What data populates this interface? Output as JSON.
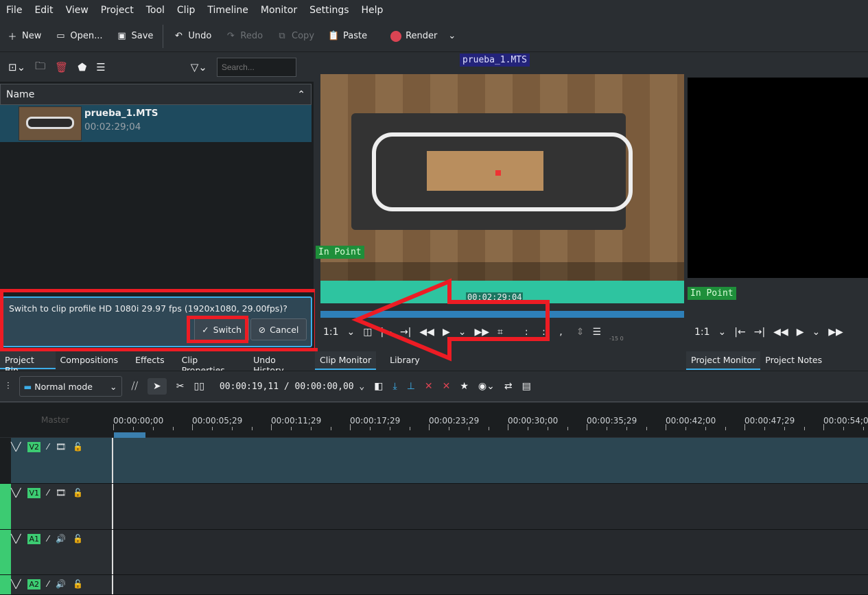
{
  "menu": [
    "File",
    "Edit",
    "View",
    "Project",
    "Tool",
    "Clip",
    "Timeline",
    "Monitor",
    "Settings",
    "Help"
  ],
  "toolbar": {
    "new": "New",
    "open": "Open...",
    "save": "Save",
    "undo": "Undo",
    "redo": "Redo",
    "copy": "Copy",
    "paste": "Paste",
    "render": "Render"
  },
  "bin": {
    "search_placeholder": "Search...",
    "column": "Name",
    "clip": {
      "name": "prueba_1.MTS",
      "duration": "00:02:29;04"
    }
  },
  "dialog": {
    "message": "Switch to clip profile HD 1080i 29.97 fps (1920x1080, 29.00fps)?",
    "switch": "Switch",
    "cancel": "Cancel"
  },
  "left_tabs": [
    "Project Bin",
    "Compositions",
    "Effects",
    "Clip Properties",
    "Undo History"
  ],
  "clip_monitor": {
    "title": "prueba_1.MTS",
    "in_point": "In Point",
    "timecode": "00:02:29:04",
    "zoom": "1:1",
    "meter": "-15 0",
    "tabs": [
      "Clip Monitor",
      "Library"
    ],
    "tc_field": ":  :  ,"
  },
  "project_monitor": {
    "in_point": "In Point",
    "zoom": "1:1",
    "tabs": [
      "Project Monitor",
      "Project Notes"
    ]
  },
  "timeline": {
    "mode": "Normal mode",
    "position": "00:00:19,11",
    "duration": "00:00:00,00",
    "master": "Master",
    "ruler": [
      "00:00:00;00",
      "00:00:05;29",
      "00:00:11;29",
      "00:00:17;29",
      "00:00:23;29",
      "00:00:30;00",
      "00:00:35;29",
      "00:00:42;00",
      "00:00:47;29",
      "00:00:54;0"
    ],
    "tracks": [
      {
        "name": "V2",
        "type": "video"
      },
      {
        "name": "V1",
        "type": "video"
      },
      {
        "name": "A1",
        "type": "audio"
      },
      {
        "name": "A2",
        "type": "audio"
      }
    ]
  },
  "colors": {
    "accent": "#3daee9",
    "highlight": "#ed1c24",
    "track_tag": "#3ccb72",
    "in_point": "#1e8f3a"
  }
}
